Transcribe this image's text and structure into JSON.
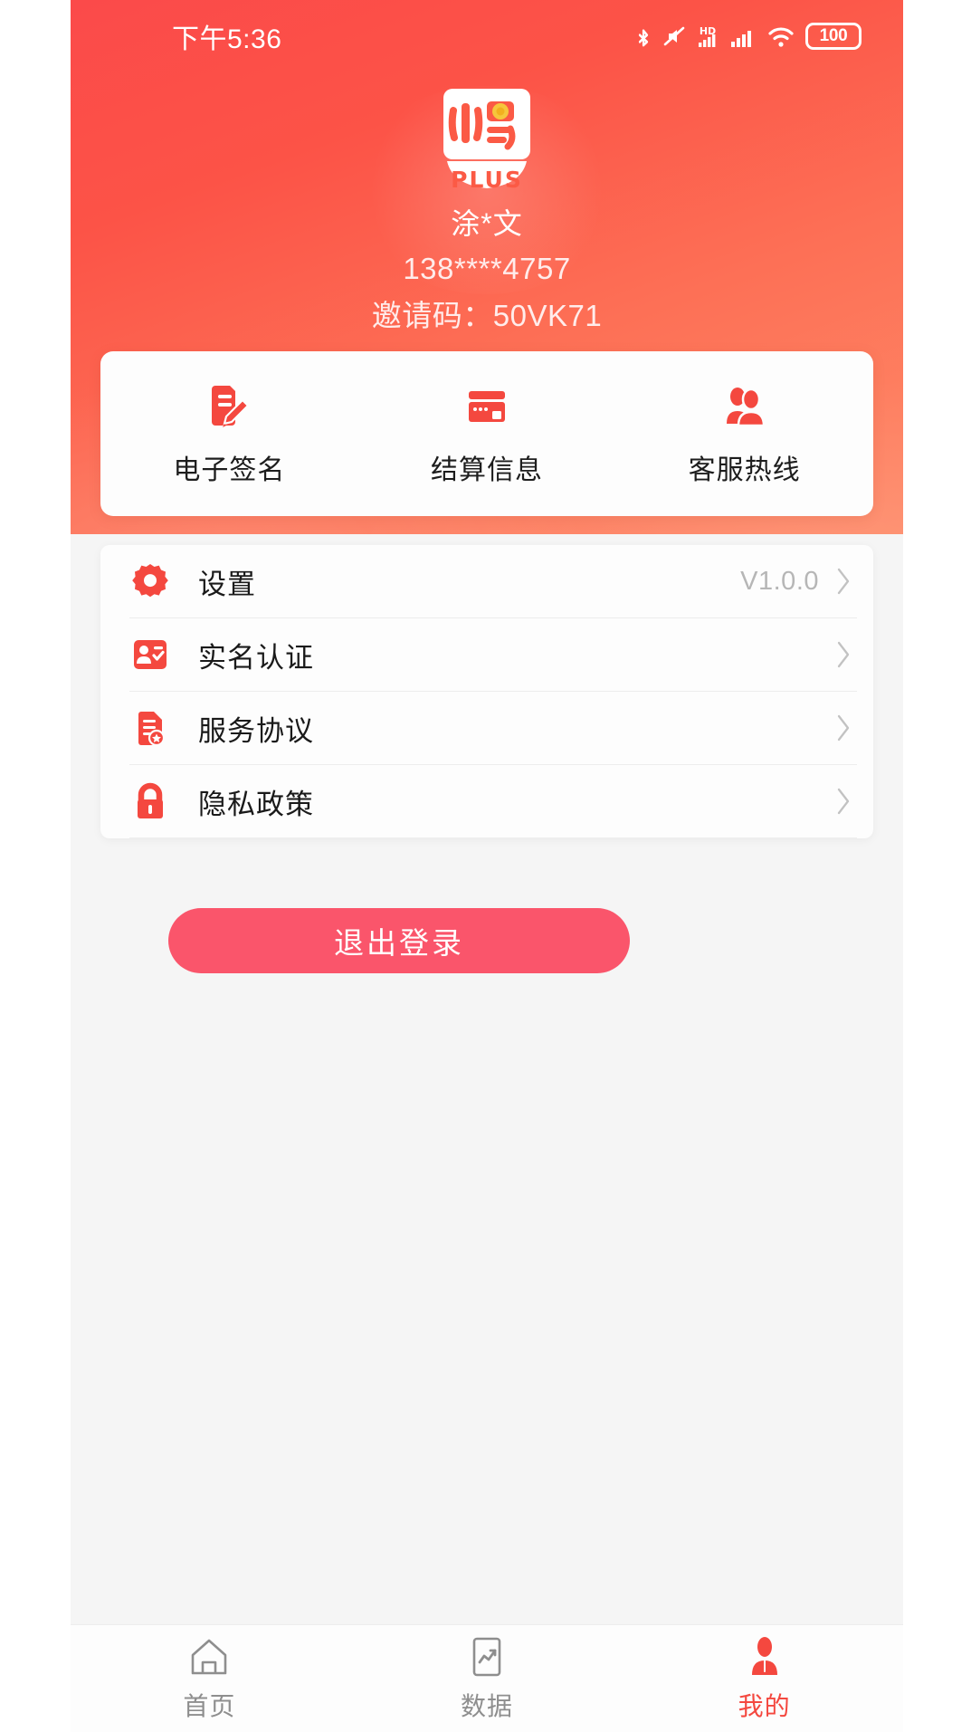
{
  "statusbar": {
    "time": "下午5:36",
    "battery": "100",
    "icons": [
      "bluetooth-icon",
      "mute-icon",
      "hd-icon",
      "signal-icon",
      "wifi-icon",
      "battery-icon"
    ]
  },
  "header": {
    "logo_text": "小易",
    "logo_sub": "PLUS",
    "user_name": "涂*文",
    "phone": "138****4757",
    "invite_code": "邀请码：50VK71"
  },
  "quick_actions": [
    {
      "label": "电子签名",
      "icon": "signature-document-icon"
    },
    {
      "label": "结算信息",
      "icon": "credit-card-icon"
    },
    {
      "label": "客服热线",
      "icon": "customer-service-people-icon"
    }
  ],
  "settings": [
    {
      "label": "设置",
      "icon": "gear-icon",
      "value": "V1.0.0"
    },
    {
      "label": "实名认证",
      "icon": "id-card-icon",
      "value": ""
    },
    {
      "label": "服务协议",
      "icon": "agreement-icon",
      "value": ""
    },
    {
      "label": "隐私政策",
      "icon": "lock-icon",
      "value": ""
    }
  ],
  "logout": {
    "label": "退出登录"
  },
  "tabbar": [
    {
      "label": "首页",
      "icon": "home-icon",
      "active": false
    },
    {
      "label": "数据",
      "icon": "chart-icon",
      "active": false
    },
    {
      "label": "我的",
      "icon": "person-icon",
      "active": true
    }
  ],
  "colors": {
    "brand_red": "#f4483f",
    "header_top": "#fb4a4a",
    "header_bottom": "#fe8a68",
    "logout_pink": "#fa556b",
    "icon_red": "#f4483f",
    "muted_text": "#b6b6b6"
  }
}
